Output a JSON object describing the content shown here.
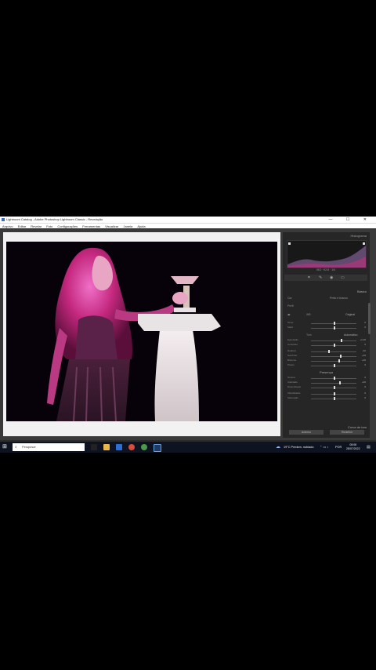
{
  "window": {
    "title": "Lightroom Catalog - Adobe Photoshop Lightroom Classic - Revelação",
    "controls": "—  ☐  ✕"
  },
  "menu": [
    "Arquivo",
    "Editar",
    "Revelar",
    "Foto",
    "Configurações",
    "Ferramentas",
    "Visualizar",
    "Janela",
    "Ajuda"
  ],
  "panel": {
    "histogram_label": "Histograma",
    "histogram_values": "ISO  ·  f/2.8  ·  1/4",
    "original_photo": "Foto original",
    "basic_label": "Básico",
    "treatment_color": "Cor",
    "treatment_bw": "Preto e branco",
    "profile_label": "Perfil",
    "wb_label": "WB",
    "wb_value": "Original",
    "tone_label": "Tom",
    "tone_auto": "Automático",
    "presence_label": "Presença",
    "sliders": [
      {
        "label": "Temp",
        "value": "0",
        "pos": 0.5
      },
      {
        "label": "Matiz",
        "value": "0",
        "pos": 0.5
      },
      {
        "label": "Exposição",
        "value": "+1,00",
        "pos": 0.65
      },
      {
        "label": "Contraste",
        "value": "0",
        "pos": 0.5
      },
      {
        "label": "Realces",
        "value": "-32",
        "pos": 0.38
      },
      {
        "label": "Sombras",
        "value": "+36",
        "pos": 0.64
      },
      {
        "label": "Brancos",
        "value": "+26",
        "pos": 0.6
      },
      {
        "label": "Pretos",
        "value": "0",
        "pos": 0.5
      },
      {
        "label": "Textura",
        "value": "0",
        "pos": 0.5
      },
      {
        "label": "Claridade",
        "value": "+30",
        "pos": 0.62
      },
      {
        "label": "Desembaçar",
        "value": "0",
        "pos": 0.5
      },
      {
        "label": "Vibratilidade",
        "value": "0",
        "pos": 0.5
      },
      {
        "label": "Saturação",
        "value": "0",
        "pos": 0.5
      }
    ],
    "curve_label": "Curva de tom",
    "prev_button": "Anterior",
    "reset_button": "Redefinir"
  },
  "taskbar": {
    "search_placeholder": "Pesquisar",
    "weather": "19°C  Predom. nublado",
    "lang": "POR",
    "time": "08:08",
    "date": "28/07/2022"
  },
  "colors": {
    "accent": "#3a6fb7",
    "panel_bg": "#262626",
    "workspace": "#3a3a3a",
    "photo_magenta": "#c0307a"
  }
}
